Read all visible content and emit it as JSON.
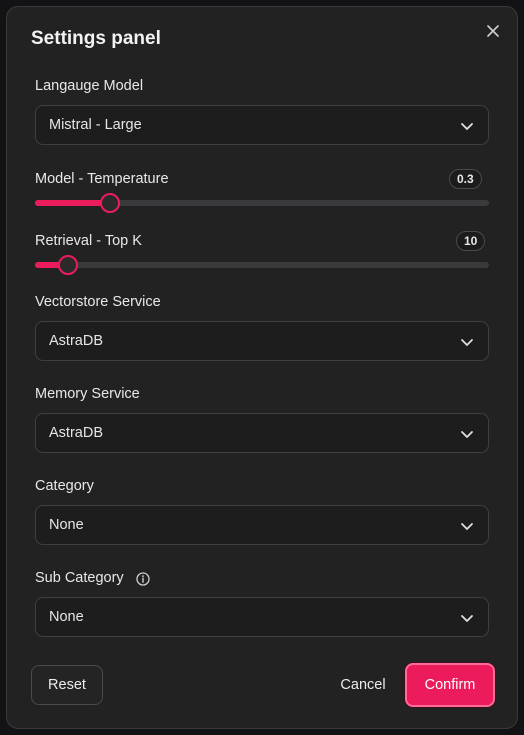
{
  "panel": {
    "title": "Settings panel"
  },
  "fields": {
    "language_model": {
      "label": "Langauge Model",
      "value": "Mistral - Large"
    },
    "temperature": {
      "label": "Model - Temperature",
      "value": "0.3",
      "fraction": 0.165
    },
    "top_k": {
      "label": "Retrieval - Top K",
      "value": "10",
      "fraction": 0.073
    },
    "vectorstore": {
      "label": "Vectorstore Service",
      "value": "AstraDB"
    },
    "memory": {
      "label": "Memory Service",
      "value": "AstraDB"
    },
    "category": {
      "label": "Category",
      "value": "None"
    },
    "sub_category": {
      "label": "Sub Category",
      "value": "None"
    }
  },
  "buttons": {
    "reset": "Reset",
    "cancel": "Cancel",
    "confirm": "Confirm"
  },
  "icons": {
    "close": "close-icon",
    "chevron": "chevron-down-icon",
    "info": "info-icon"
  },
  "colors": {
    "accent": "#ec1c5c",
    "panel_bg": "#222223"
  }
}
